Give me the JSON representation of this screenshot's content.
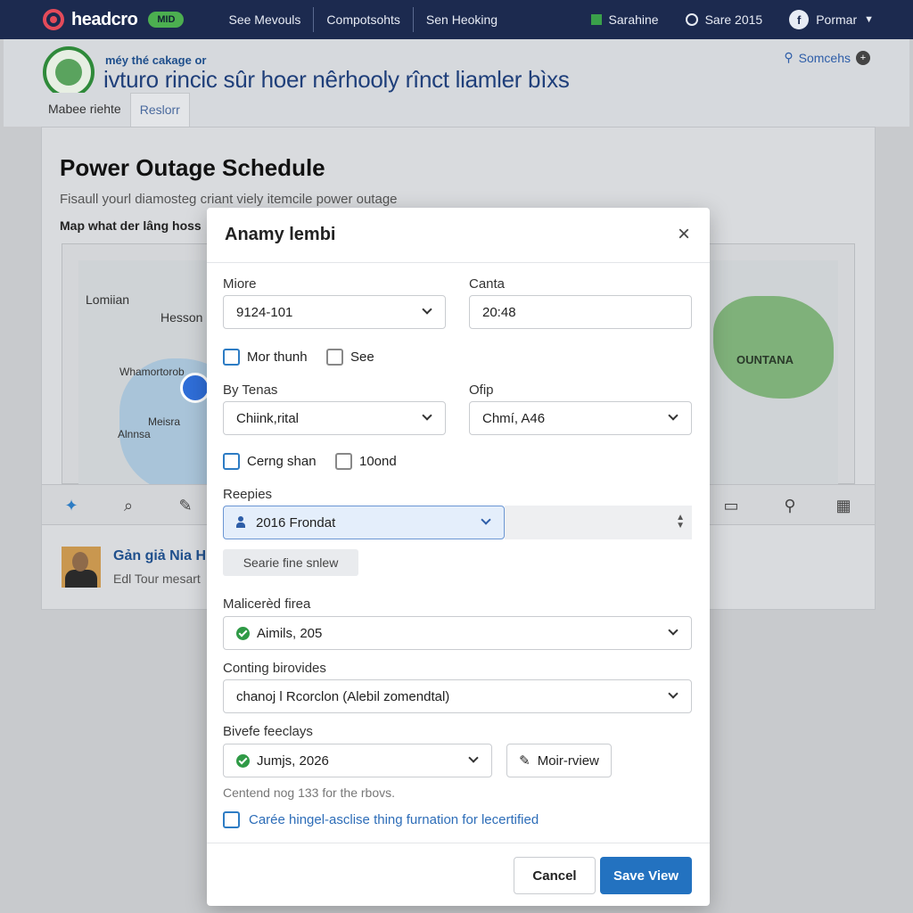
{
  "nav": {
    "brand": "headcro",
    "badge": "MID",
    "links": [
      "See Mevouls",
      "Compotsohts",
      "Sen Heoking"
    ],
    "right": {
      "item1": "Sarahine",
      "item2": "Sare 2015",
      "user": "Pormar",
      "avatar_letter": "f"
    }
  },
  "header": {
    "subtitle": "méy thé cakage or",
    "title": "ivturo rincic sûr hoer nêrhooly rînct liamler bìxs",
    "link": "Somcehs",
    "link_badge": "+"
  },
  "subtabs": [
    "Mabee riehte",
    "Reslorr"
  ],
  "page": {
    "title": "Power Outage Schedule",
    "description": "Fisaull yourl diamosteg criant viely itemcile power outage",
    "map_label": "Map what der lâng hoss"
  },
  "map": {
    "places": [
      "Lomiian",
      "Hesson",
      "Whamortorob",
      "Meisra",
      "Alnnsa"
    ],
    "region": "OUNTANA"
  },
  "person": {
    "name": "Gản giả Nia H",
    "subtitle": "Edl Tour mesart"
  },
  "modal": {
    "title": "Anamy lembi",
    "close": "×",
    "field1": {
      "label": "Miore",
      "value": "9124-101"
    },
    "field2": {
      "label": "Canta",
      "value": "20:48"
    },
    "check1": "Mor thunh",
    "check2": "See",
    "field3": {
      "label": "By Tenas",
      "value": "Chiink,rital"
    },
    "field4": {
      "label": "Ofip",
      "value": "Chmí, A46"
    },
    "check3": "Cerng shan",
    "check4": "10ond",
    "field5": {
      "label": "Reepies",
      "value": "2016 Frondat"
    },
    "ghost_button": "Searie fine snlew",
    "field6": {
      "label": "Malicerèd firea",
      "value": "Aimils, 205"
    },
    "field7": {
      "label": "Conting birovides",
      "value": "chanoj l Rcorclon (Alebil zomendtal)"
    },
    "field8": {
      "label": "Bivefe feeclays",
      "value": "Jumjs, 2026"
    },
    "preview_button": "Moir-rview",
    "note": "Centend nog 133 for the rbovs.",
    "link_check": "Carée hingel-asclise thing furnation for lecertified",
    "cancel": "Cancel",
    "save": "Save View"
  },
  "colors": {
    "nav_bg": "#1c2a4f",
    "primary": "#2372c0",
    "success": "#2f9a46",
    "badge": "#4caf50"
  }
}
